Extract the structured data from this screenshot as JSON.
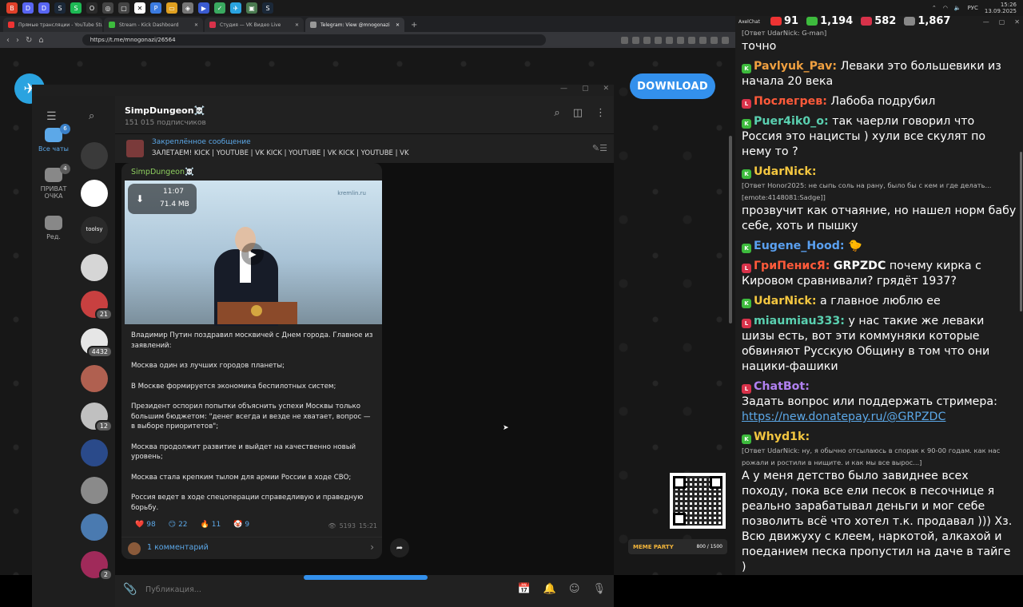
{
  "taskbar": {
    "icons": [
      {
        "name": "brave-icon",
        "color": "#e0402a",
        "glyph": "B"
      },
      {
        "name": "chat-icon",
        "color": "#5865f2",
        "glyph": "D"
      },
      {
        "name": "discord-icon",
        "color": "#5865f2",
        "glyph": "D"
      },
      {
        "name": "steam-icon",
        "color": "#1b2838",
        "glyph": "S"
      },
      {
        "name": "spotify-icon",
        "color": "#1db954",
        "glyph": "S"
      },
      {
        "name": "obs-icon",
        "color": "#2a2a2a",
        "glyph": "O"
      },
      {
        "name": "app-icon",
        "color": "#444",
        "glyph": "◎"
      },
      {
        "name": "window-icon",
        "color": "#444",
        "glyph": "▢"
      },
      {
        "name": "tool-icon",
        "color": "#fff",
        "glyph": "✕"
      },
      {
        "name": "app2-icon",
        "color": "#3b7be0",
        "glyph": "P"
      },
      {
        "name": "folder-icon",
        "color": "#e0a020",
        "glyph": "▭"
      },
      {
        "name": "app3-icon",
        "color": "#777",
        "glyph": "◈"
      },
      {
        "name": "app4-icon",
        "color": "#3a5bd0",
        "glyph": "▶"
      },
      {
        "name": "app5-icon",
        "color": "#3aaa60",
        "glyph": "✓"
      },
      {
        "name": "telegram-icon",
        "color": "#2aa3e0",
        "glyph": "✈"
      },
      {
        "name": "app6-icon",
        "color": "#4a7a50",
        "glyph": "▣"
      },
      {
        "name": "steam2-icon",
        "color": "#1b2838",
        "glyph": "S"
      }
    ],
    "lang": "РУС",
    "time": "15:26",
    "date": "13.09.2025"
  },
  "browser": {
    "tabs": [
      {
        "label": "Прямые трансляции - YouTube Studio",
        "color": "#e33",
        "active": false
      },
      {
        "label": "Stream - Kick Dashboard",
        "color": "#3dbb3d",
        "active": false
      },
      {
        "label": "Студия — VK Видео Live",
        "color": "#d8324a",
        "active": false
      },
      {
        "label": "Telegram: View @mnogonazi",
        "color": "#999",
        "active": true
      }
    ],
    "url": "https://t.me/mnogonazi/26564"
  },
  "telegram": {
    "download_label": "DOWNLOAD",
    "folders": [
      {
        "label": "Все чаты",
        "badge": "6",
        "active": true
      },
      {
        "label": "ПРИВАТ ОЧКА",
        "badge": "4",
        "active": false
      },
      {
        "label": "Ред.",
        "badge": "",
        "active": false
      }
    ],
    "avatars": [
      {
        "color": "#3a3a3a",
        "badge": ""
      },
      {
        "color": "#fff",
        "badge": ""
      },
      {
        "color": "#2a2a2a",
        "badge": "",
        "text": "toolsy"
      },
      {
        "color": "#d6d6d6",
        "badge": ""
      },
      {
        "color": "#c84040",
        "badge": "21"
      },
      {
        "color": "#e6e6e6",
        "badge": "4432"
      },
      {
        "color": "#b06050",
        "badge": ""
      },
      {
        "color": "#c0c0c0",
        "badge": "12"
      },
      {
        "color": "#2a4a8a",
        "badge": ""
      },
      {
        "color": "#8a8a8a",
        "badge": ""
      },
      {
        "color": "#4a7ab0",
        "badge": ""
      },
      {
        "color": "#a02a5a",
        "badge": "2"
      }
    ],
    "channel": {
      "title": "SimpDungeon☠️",
      "subscribers": "151 015 подписчиков"
    },
    "pinned": {
      "title": "Закреплённое сообщение",
      "text": "ЗАЛЕТАЕМ!  KICK | YOUTUBE | VK KICK | YOUTUBE | VK KICK | YOUTUBE | VK"
    },
    "message": {
      "author": "SimpDungeon☠️",
      "video_duration": "11:07",
      "video_size": "71.4 MB",
      "watermark": "kremlin.ru",
      "paragraphs": [
        "Владимир Путин поздравил москвичей с Днем города. Главное из заявлений:",
        "Москва один из лучших городов планеты;",
        "В Москве формируется экономика беспилотных систем;",
        "Президент оспорил попытки объяснить успехи Москвы только большим бюджетом: \"денег всегда и везде не хватает, вопрос — в выборе приоритетов\";",
        "Москва продолжит развитие и выйдет на качественно новый уровень;",
        "Москва стала крепким тылом для армии России в ходе СВО;",
        "Россия ведет в ходе спецоперации справедливую и праведную борьбу."
      ],
      "reactions": [
        {
          "emoji": "❤️",
          "count": "98"
        },
        {
          "emoji": "😏",
          "count": "22"
        },
        {
          "emoji": "🔥",
          "count": "11"
        },
        {
          "emoji": "🤡",
          "count": "9"
        }
      ],
      "views": "5193",
      "time": "15:21",
      "comments_label": "1 комментарий"
    },
    "composer_placeholder": "Публикация..."
  },
  "overlay": {
    "meme_title": "MEME PARTY",
    "meme_count": "800 / 1500"
  },
  "chat_panel": {
    "app_name": "AxelChat",
    "stats": [
      {
        "platform": "youtube",
        "value": "91",
        "color": "#e33"
      },
      {
        "platform": "kick",
        "value": "1,194",
        "color": "#3dbb3d"
      },
      {
        "platform": "vk",
        "value": "582",
        "color": "#d8324a"
      },
      {
        "platform": "viewers",
        "value": "1,867",
        "color": "#888"
      }
    ],
    "messages": [
      {
        "reply": "[Ответ UdarNick: G-man]",
        "text": "точно"
      },
      {
        "platform": "kick",
        "nick": "Pavlyuk_Pav:",
        "nick_color": "#f0a040",
        "text": "Леваки это большевики из начала 20 века"
      },
      {
        "platform": "vk",
        "nick": "Послегрев:",
        "nick_color": "#ff5a3a",
        "text": "Лабоба подрубил"
      },
      {
        "platform": "kick",
        "nick": "Puer4ik0_o:",
        "nick_color": "#5ad0b0",
        "text": "так чаерли говорил что Россия это нацисты ) хули все скулят по нему то ?"
      },
      {
        "platform": "kick",
        "nick": "UdarNick:",
        "nick_color": "#f3c640",
        "reply": "[Ответ Honor2025: не сыпь соль на рану, было бы с кем и где делать... [emote:4148081:Sadge]]",
        "text": "прозвучит как отчаяние, но нашел норм бабу себе, хоть и пышку"
      },
      {
        "platform": "kick",
        "nick": "Eugene_Hood:",
        "nick_color": "#5aa0f0",
        "text": "🐤"
      },
      {
        "platform": "vk",
        "nick": "ГриПенисЯ:",
        "nick_color": "#ff5a3a",
        "bold": "GRPZDC",
        "text": "почему кирка с Кировом сравнивали? грядёт 1937?"
      },
      {
        "platform": "kick",
        "nick": "UdarNick:",
        "nick_color": "#f3c640",
        "text": "а главное люблю ее"
      },
      {
        "platform": "vk",
        "nick": "miaumiau333:",
        "nick_color": "#5ad0b0",
        "text": "у нас такие же леваки шизы есть, вот эти коммуняки которые обвиняют Русскую Общину в том что они нацики-фашики"
      },
      {
        "platform": "vk",
        "nick": "ChatBot:",
        "nick_color": "#b080f0",
        "text": "Задать вопрос или поддержать стримера:",
        "link": "https://new.donatepay.ru/@GRPZDC"
      },
      {
        "platform": "kick",
        "nick": "Whyd1k:",
        "nick_color": "#f3c640",
        "reply": "[Ответ UdarNick: ну, я обычно отсылаюсь в спорак к 90-00 годам. как нас рожали и ростили в нищите. и как мы все вырос...]",
        "text": "А у меня детство было завиднее всех походу, пока все ели песок в песочнице я реально зарабатывал деньги и мог себе позволить всё что хотел т.к. продавал ))) Хз. Всю движуху с клеем, наркотой, алкахой и поеданием песка пропустил на даче в тайге )"
      }
    ]
  }
}
